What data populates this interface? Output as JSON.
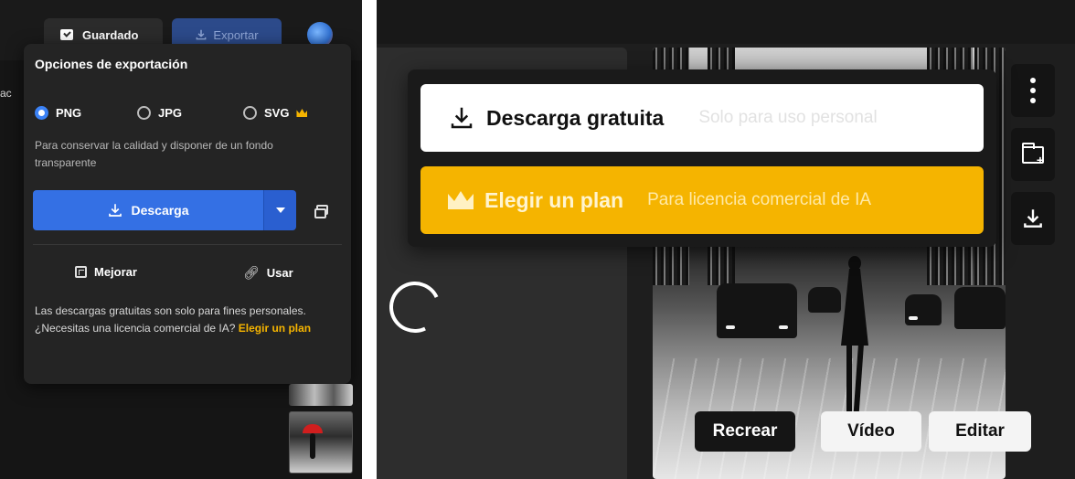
{
  "left": {
    "sliver_text": "ac",
    "header": {
      "saved_label": "Guardado",
      "export_label": "Exportar"
    },
    "export_panel": {
      "title": "Opciones de exportación",
      "formats": [
        {
          "label": "PNG",
          "selected": true
        },
        {
          "label": "JPG",
          "selected": false
        },
        {
          "label": "SVG",
          "selected": false,
          "premium": true
        }
      ],
      "description": "Para conservar la calidad y disponer de un fondo transparente",
      "download_label": "Descarga",
      "tools": {
        "improve_label": "Mejorar",
        "use_label": "Usar"
      },
      "note_text": "Las descargas gratuitas son solo para fines personales.",
      "note_question": "¿Necesitas una licencia comercial de IA?",
      "note_cta": "Elegir un plan"
    }
  },
  "right": {
    "popup": {
      "free_label": "Descarga gratuita",
      "free_sub": "Solo para uso personal",
      "plan_label": "Elegir un plan",
      "plan_sub": "Para licencia comercial de IA"
    },
    "actions": {
      "recrear": "Recrear",
      "video": "Vídeo",
      "editar": "Editar"
    }
  },
  "colors": {
    "accent_blue": "#3470e4",
    "accent_gold": "#f5b400",
    "panel_bg": "#242424"
  },
  "icons": [
    "check-folder-icon",
    "download-icon",
    "crown-icon",
    "caret-down-icon",
    "copy-icon",
    "enhance-icon",
    "link-icon",
    "more-vertical-icon",
    "folder-add-icon",
    "spinner-icon"
  ]
}
